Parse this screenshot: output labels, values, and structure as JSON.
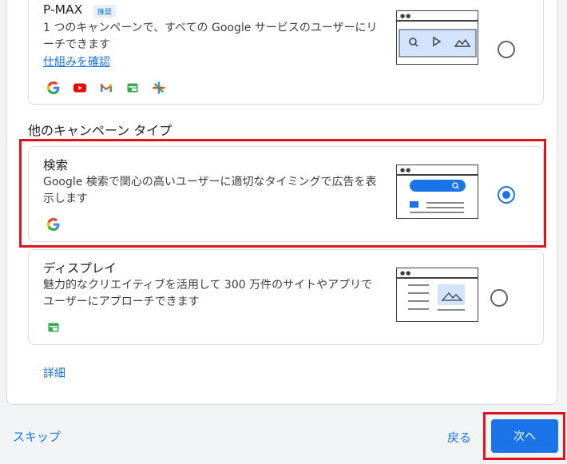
{
  "cards": {
    "pmax": {
      "title": "P-MAX",
      "badge": "推奨",
      "description": "1 つのキャンペーンで、すべての Google サービスのユーザーにリーチできます",
      "link": "仕組みを確認",
      "selected": false,
      "icons": [
        "google-icon",
        "youtube-icon",
        "gmail-icon",
        "display-icon",
        "discover-icon"
      ]
    },
    "search": {
      "title": "検索",
      "description": "Google 検索で関心の高いユーザーに適切なタイミングで広告を表示します",
      "selected": true,
      "icons": [
        "google-icon"
      ]
    },
    "display": {
      "title": "ディスプレイ",
      "description": "魅力的なクリエイティブを活用して 300 万件のサイトやアプリでユーザーにアプローチできます",
      "selected": false,
      "icons": [
        "display-icon"
      ]
    }
  },
  "section": {
    "other_types": "他のキャンペーン タイプ"
  },
  "more_link": "詳細",
  "footer": {
    "skip": "スキップ",
    "back": "戻る",
    "next": "次へ"
  },
  "colors": {
    "accent": "#1a73e8",
    "highlight": "#e1141e",
    "illustration_fill": "#d2e3fc"
  }
}
